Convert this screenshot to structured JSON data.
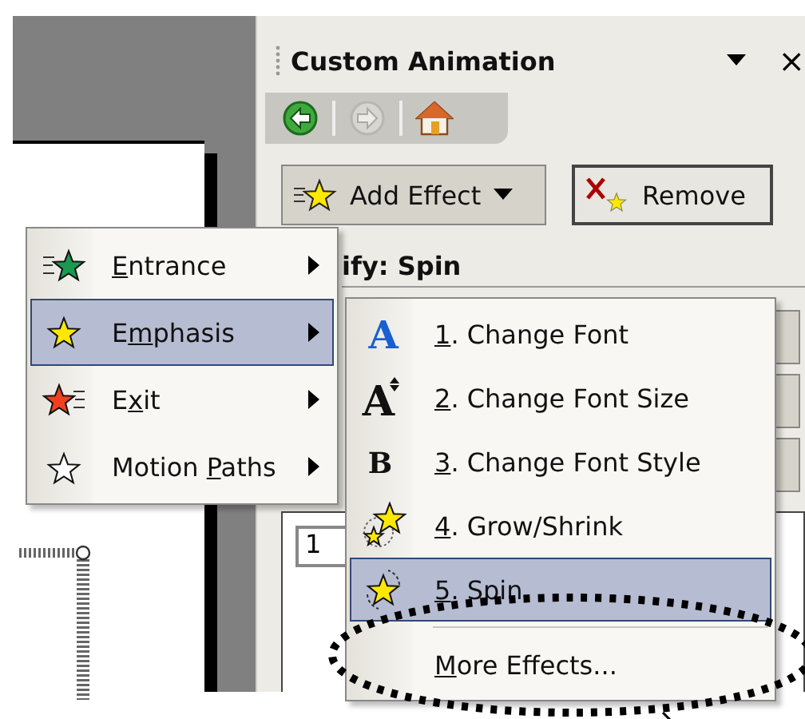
{
  "window": {
    "title": "Custom Animation"
  },
  "title_buttons": [
    {
      "kind": "dropdown"
    },
    {
      "kind": "close",
      "label": "×"
    }
  ],
  "toolbar": [
    {
      "kind": "back",
      "disabled": false
    },
    {
      "kind": "forward",
      "disabled": true
    },
    {
      "kind": "home",
      "disabled": false
    }
  ],
  "buttons": [
    {
      "kind": "add",
      "label": "Add Effect"
    },
    {
      "kind": "remove",
      "label": "Remove"
    }
  ],
  "modify_label": "ify: Spin",
  "effect_list": {
    "items": [
      "1"
    ]
  },
  "menu": {
    "items": [
      {
        "kind": "entrance",
        "label": {
          "key": "E",
          "after": "ntrance"
        },
        "selected": false
      },
      {
        "kind": "emphasis",
        "label": {
          "before": "E",
          "key": "m",
          "after": "phasis"
        },
        "selected": true
      },
      {
        "kind": "exit",
        "label": {
          "before": "E",
          "key": "x",
          "after": "it"
        },
        "selected": false
      },
      {
        "kind": "motion",
        "label": {
          "before": "Motion ",
          "key": "P",
          "after": "aths"
        },
        "selected": false
      }
    ]
  },
  "submenu": {
    "items": [
      {
        "kind": "font",
        "icon_text": "A",
        "label": {
          "key": "1",
          "after": ". Change Font"
        },
        "selected": false
      },
      {
        "kind": "size",
        "icon_text": "A",
        "label": {
          "key": "2",
          "after": ". Change Font Size"
        },
        "selected": false
      },
      {
        "kind": "style",
        "icon_text": "B",
        "label": {
          "key": "3",
          "after": ". Change Font Style"
        },
        "selected": false
      },
      {
        "kind": "grow",
        "label": {
          "key": "4",
          "after": ". Grow/Shrink"
        },
        "selected": false
      },
      {
        "kind": "spin",
        "label": {
          "key": "5",
          "after": ". Spin"
        },
        "selected": true
      },
      {
        "kind": "more",
        "label": {
          "key": "M",
          "after": "ore Effects..."
        },
        "selected": false
      }
    ]
  }
}
